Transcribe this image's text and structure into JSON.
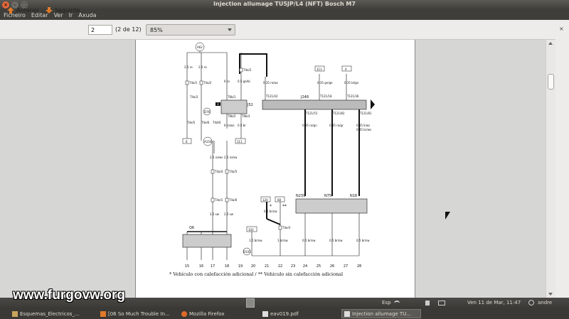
{
  "window": {
    "title": "Injection allumage TU5JP/L4 (NFT) Bosch M7",
    "buttons": [
      "×",
      "–",
      "□"
    ]
  },
  "menu": [
    "Ficheiro",
    "Editar",
    "Ver",
    "Ir",
    "Axuda"
  ],
  "toolbar": {
    "prev_label": "Anterior",
    "next_label": "Seguinte",
    "page_value": "2",
    "page_count": "(2 de 12)",
    "zoom": "85%",
    "close_doc": "×"
  },
  "diagram": {
    "top_labels": [
      "A62",
      "111",
      "4"
    ],
    "components": [
      "J248",
      "J52",
      "N239",
      "N75",
      "N18",
      "Q6"
    ],
    "box_labels": [
      "3",
      "6",
      "111",
      "120",
      "68",
      "102",
      "D76",
      "A150",
      "D101"
    ],
    "wire_labels": [
      "2.5 ro",
      "2.5 ro",
      "6 ro",
      "0.5 ge/bl",
      "0.35 ro/ws",
      "0.35 gn/ge",
      "0.35 bl/gn",
      "0.35 ro/gn",
      "0.35 ro/gr",
      "0.35 li/ws",
      "0.35 br/ws",
      "6 ro/ws",
      "0.5 br",
      "2.5 ro/ws",
      "2.5 ro/sw",
      "2.5 sw",
      "2.5 sw",
      "1.5 br/sw",
      "0.5 br/sw",
      "1 br/sw",
      "0.5 br/sw",
      "0.5 br/sw",
      "0.5 br/sw"
    ],
    "terminals": [
      "T4a/1",
      "T4a/2",
      "T4a/3",
      "T4a/4",
      "T4e/2",
      "T6b/1",
      "T6b/2",
      "T6b/3",
      "T121/42",
      "T121/18",
      "T121/36",
      "T121/51",
      "T121/82",
      "T121/81",
      "T4a/5",
      "T4e/1",
      "T4a/6",
      "T4e/3",
      "T4e/5",
      "T4e/6",
      "T4d/0"
    ],
    "column_numbers": [
      "15",
      "16",
      "17",
      "18",
      "19",
      "20",
      "21",
      "22",
      "23",
      "24",
      "25",
      "26",
      "27",
      "28"
    ],
    "marker_star": "*",
    "marker_double_star": "**",
    "footnote": "* Vehículo con calefacción adicional  /  ** Vehículo sin calefacción adicional"
  },
  "watermark": "www.furgovw.org",
  "systray": {
    "lang": "Esp",
    "clock": "Ven 11 de Mar, 11:47",
    "user": "andre"
  },
  "taskbar": [
    {
      "label": "Esquemas_Electricos_..."
    },
    {
      "label": "[06 So Much Trouble In..."
    },
    {
      "label": "Mozilla Firefox"
    },
    {
      "label": "eav019.pdf"
    },
    {
      "label": "Injection allumage TU..."
    }
  ]
}
